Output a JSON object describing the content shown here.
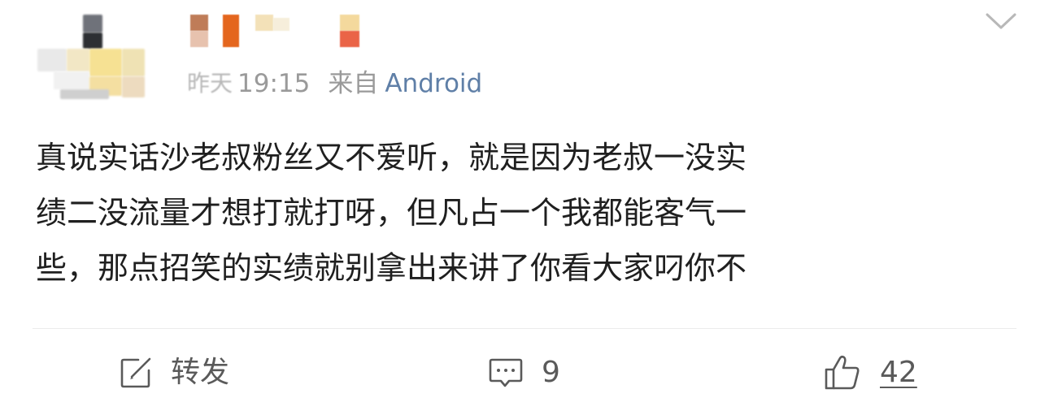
{
  "post": {
    "meta": {
      "date_fragment": "昨天",
      "time": "19:15",
      "from_label": "来自",
      "source": "Android"
    },
    "content_lines": [
      "真说实话沙老叔粉丝又不爱听，就是因为老叔一没实",
      "绩二没流量才想打就打呀，但凡占一个我都能客气一",
      "些，那点招笑的实绩就别拿出来讲了你看大家叼你不"
    ],
    "actions": {
      "repost_label": "转发",
      "comment_count": "9",
      "like_count": "42"
    }
  },
  "icons": {
    "collapse": "chevron-down-icon",
    "repost": "repost-edit-icon",
    "comment": "comment-bubble-icon",
    "like": "thumbs-up-icon"
  },
  "colors": {
    "text": "#1f1f1f",
    "meta": "#9a9a9a",
    "link": "#5f7fa7",
    "action": "#5a5a5a",
    "divider": "#ececec"
  }
}
